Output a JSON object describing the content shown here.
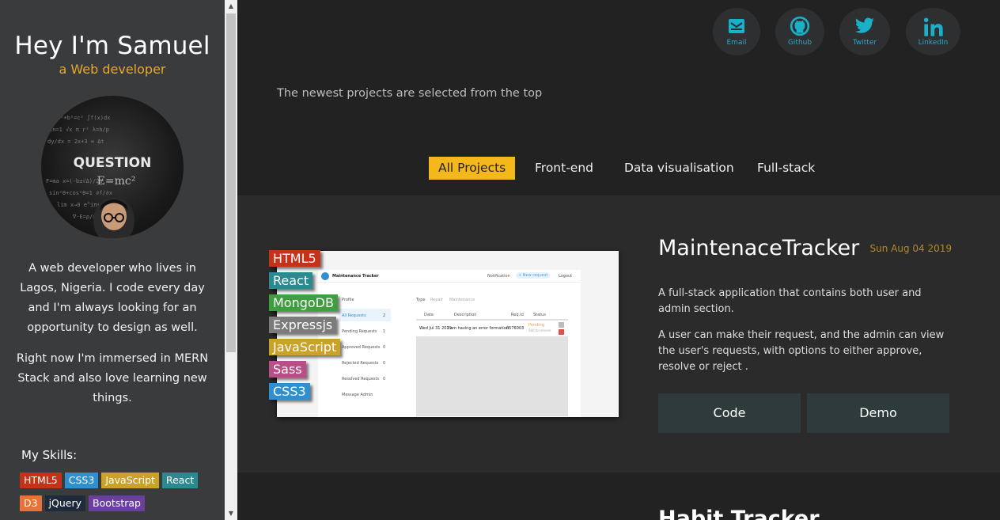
{
  "sidebar": {
    "name": "Hey I'm Samuel",
    "role": "a Web developer",
    "avatar_text": "QUESTION",
    "bio": [
      "A web developer who lives in Lagos, Nigeria. I code every day and I'm always looking for an opportunity to design as well.",
      "Right now I'm immersed in MERN Stack and also love learning new things."
    ],
    "skills_title": "My Skills:",
    "skills": [
      {
        "label": "HTML5",
        "color": "#c5321a"
      },
      {
        "label": "CSS3",
        "color": "#2f8fcf"
      },
      {
        "label": "JavaScript",
        "color": "#c9a227"
      },
      {
        "label": "React",
        "color": "#2a8a8f"
      },
      {
        "label": "D3",
        "color": "#e8733a"
      },
      {
        "label": "jQuery",
        "color": "#1f2b3a"
      },
      {
        "label": "Bootstrap",
        "color": "#6b3fa0"
      }
    ]
  },
  "socials": [
    {
      "label": "Email",
      "icon": "email-icon"
    },
    {
      "label": "Github",
      "icon": "github-icon"
    },
    {
      "label": "Twitter",
      "icon": "twitter-icon"
    },
    {
      "label": "LinkedIn",
      "icon": "linkedin-icon"
    }
  ],
  "tagline": "The newest projects are selected from the top",
  "filters": [
    {
      "label": "All Projects",
      "active": true
    },
    {
      "label": "Front-end",
      "active": false
    },
    {
      "label": "Data visualisation",
      "active": false
    },
    {
      "label": "Full-stack",
      "active": false
    }
  ],
  "project": {
    "title": "MaintenaceTracker",
    "date": "Sun Aug 04 2019",
    "description": [
      "A full-stack application that contains both user and admin section.",
      "A user can make their request, and the admin can view the user's requests, with options to either approve, resolve or reject ."
    ],
    "tags": [
      {
        "label": "HTML5",
        "color": "#c5321a"
      },
      {
        "label": "React",
        "color": "#2a8a8f"
      },
      {
        "label": "MongoDB",
        "color": "#3f9e3f"
      },
      {
        "label": "Expressjs",
        "color": "#7b7b7b"
      },
      {
        "label": "JavaScript",
        "color": "#c9a227"
      },
      {
        "label": "Sass",
        "color": "#b84f86"
      },
      {
        "label": "CSS3",
        "color": "#2f8fcf"
      }
    ],
    "code_label": "Code",
    "demo_label": "Demo",
    "screenshot": {
      "app_title": "Maintenance Tracker",
      "notification": "Notification",
      "new_request": "+ New request",
      "logout": "Logout",
      "profile": "Profile",
      "menu": [
        "All Requests",
        "Pending Requests",
        "Approved Requests",
        "Rejected Requests",
        "Resolved Requests",
        "Message Admin"
      ],
      "menu_counts": [
        "2",
        "1",
        "0",
        "0",
        "0",
        ""
      ],
      "type_label": "Type",
      "type_options": [
        "Repair",
        "Maintenance"
      ],
      "columns": [
        "Date",
        "Description",
        "Req.Id",
        "Status"
      ],
      "row": {
        "date": "Wed Jul 31 2019",
        "description": "I am having an error formation.",
        "id": "0576003",
        "status": "Pending",
        "status_sub": "Still to resolve"
      }
    }
  },
  "next_project_title": "Habit Tracker"
}
